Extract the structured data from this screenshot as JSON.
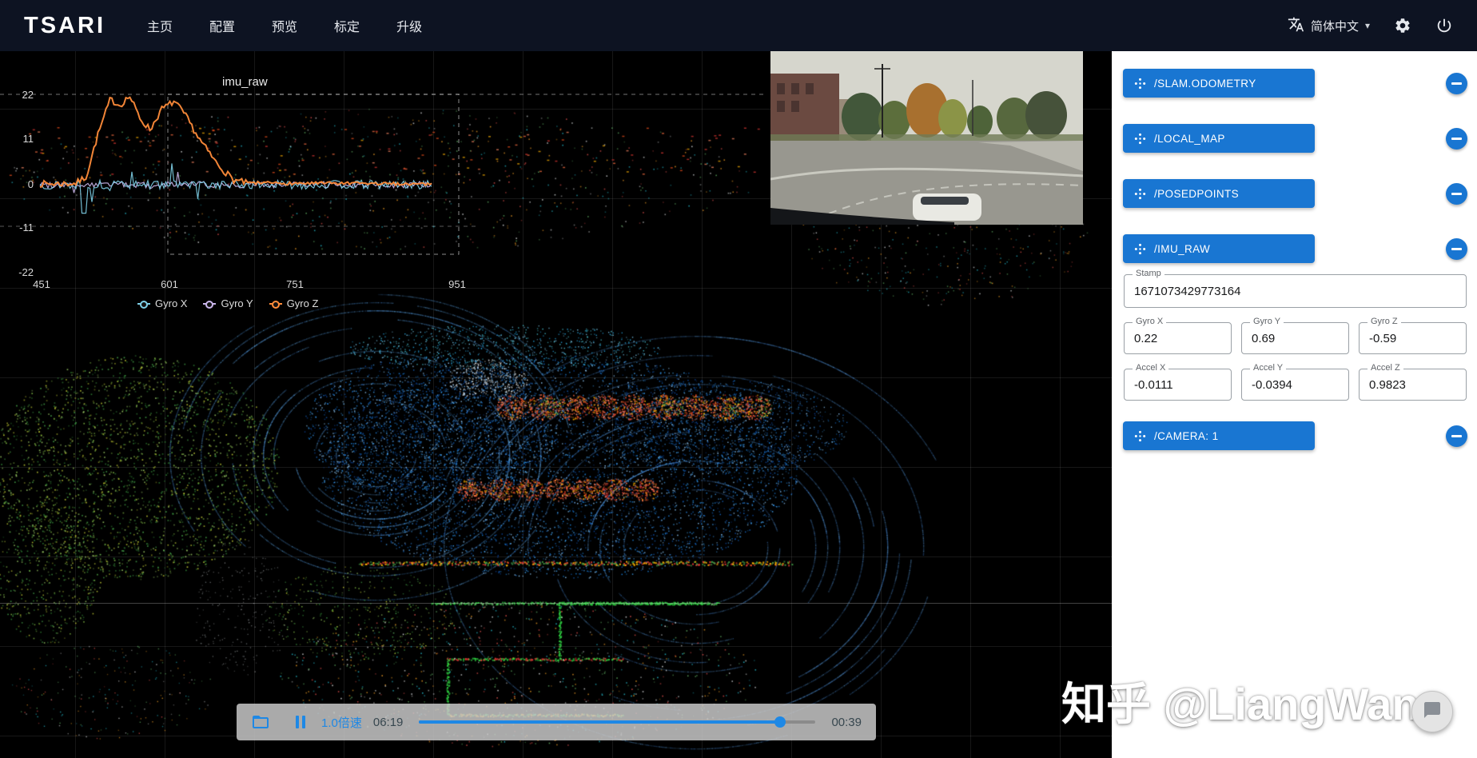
{
  "app": {
    "title": "TSARI"
  },
  "header": {
    "nav": [
      {
        "label": "主页"
      },
      {
        "label": "配置"
      },
      {
        "label": "预览"
      },
      {
        "label": "标定"
      },
      {
        "label": "升级"
      }
    ],
    "language": {
      "label": "简体中文"
    }
  },
  "viewer": {
    "imu_chart": {
      "title": "imu_raw",
      "y_ticks": [
        "22",
        "11",
        "0",
        "-11",
        "-22"
      ],
      "x_ticks": [
        "451",
        "601",
        "751",
        "951"
      ],
      "legend": [
        {
          "label": "Gyro X",
          "color": "#7ed0e8"
        },
        {
          "label": "Gyro Y",
          "color": "#cbb7ec"
        },
        {
          "label": "Gyro Z",
          "color": "#ff8c3a"
        }
      ]
    },
    "playback": {
      "speed_label": "1.0倍速",
      "position": "06:19",
      "remaining": "00:39",
      "progress_pct": 91
    }
  },
  "sidebar": {
    "topics": [
      {
        "label": "/SLAM.ODOMETRY"
      },
      {
        "label": "/LOCAL_MAP"
      },
      {
        "label": "/POSEDPOINTS"
      },
      {
        "label": "/IMU_RAW"
      },
      {
        "label": "/CAMERA: 1"
      }
    ],
    "imu_fields": {
      "stamp": {
        "label": "Stamp",
        "value": "1671073429773164"
      },
      "gyro_x": {
        "label": "Gyro X",
        "value": "0.22"
      },
      "gyro_y": {
        "label": "Gyro Y",
        "value": "0.69"
      },
      "gyro_z": {
        "label": "Gyro Z",
        "value": "-0.59"
      },
      "accel_x": {
        "label": "Accel X",
        "value": "-0.0111"
      },
      "accel_y": {
        "label": "Accel Y",
        "value": "-0.0394"
      },
      "accel_z": {
        "label": "Accel Z",
        "value": "0.9823"
      }
    }
  },
  "watermark": "知乎 @LiangWang",
  "colors": {
    "accent": "#1976d2",
    "header_bg": "#0d1322",
    "playback_blue": "#1e88e5"
  },
  "chart_data": {
    "type": "line",
    "title": "imu_raw",
    "xlabel": "",
    "ylabel": "",
    "x_ticks": [
      451,
      601,
      751,
      951
    ],
    "y_ticks": [
      22,
      11,
      0,
      -11,
      -22
    ],
    "ylim": [
      -26,
      26
    ],
    "grid": false,
    "legend_position": "bottom-left",
    "series": [
      {
        "name": "Gyro X",
        "approx": "noise around 0, amplitude ~±2, spikes to ±8 near x 480-560"
      },
      {
        "name": "Gyro Y",
        "approx": "noise around 0, amplitude ~±1.5"
      },
      {
        "name": "Gyro Z",
        "approx": "≈0 until x≈470, rises to ~22 by x≈510, oscillates 13-22 until x≈560, back to ~0 by x≈610, stays near 0 to x≈960"
      }
    ]
  }
}
